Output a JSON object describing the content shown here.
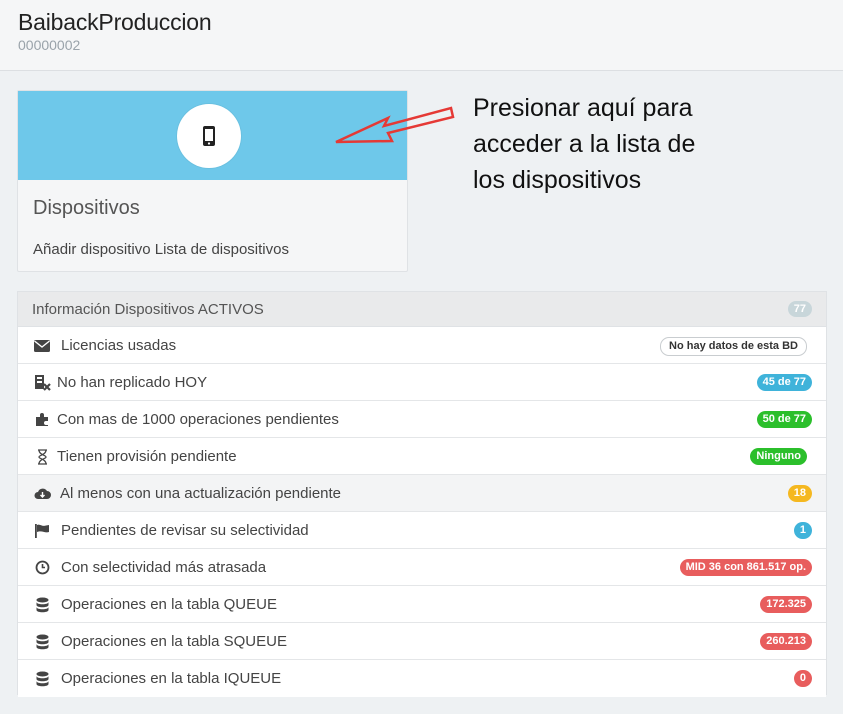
{
  "header": {
    "title": "BaibackProduccion",
    "code": "00000002"
  },
  "card": {
    "icon": "mobile-phone-icon",
    "title": "Dispositivos",
    "link_add": "Añadir dispositivo",
    "link_list": "Lista de dispositivos",
    "banner_color": "#6ec8ea"
  },
  "annotation": {
    "line1": "Presionar aquí para",
    "line2": "acceder a la lista de",
    "line3": "los dispositivos",
    "arrow_color": "#e53935"
  },
  "panel": {
    "title": "Información Dispositivos ACTIVOS",
    "count": "77",
    "rows": [
      {
        "icon": "envelope-icon",
        "label": "Licencias usadas",
        "badge": "No hay datos de esta BD",
        "badge_color": "#ffffff"
      },
      {
        "icon": "server-x-icon",
        "label": "No han replicado HOY",
        "badge": "45 de 77",
        "badge_color": "#3fb3da"
      },
      {
        "icon": "puzzle-icon",
        "label": "Con mas de 1000 operaciones pendientes",
        "badge": "50 de 77",
        "badge_color": "#2bbf2b"
      },
      {
        "icon": "hourglass-icon",
        "label": "Tienen provisión pendiente",
        "badge": "Ninguno",
        "badge_color": "#2bbf2b"
      },
      {
        "icon": "cloud-download-icon",
        "label": "Al menos con una actualización pendiente",
        "badge": "18",
        "badge_color": "#f5b820"
      },
      {
        "icon": "flag-icon",
        "label": "Pendientes de revisar su selectividad",
        "badge": "1",
        "badge_color": "#3fb3da"
      },
      {
        "icon": "clock-icon",
        "label": "Con selectividad más atrasada",
        "badge": "MID 36 con 861.517 op.",
        "badge_color": "#e85d5d"
      },
      {
        "icon": "database-icon",
        "label": "Operaciones en la tabla QUEUE",
        "badge": "172.325",
        "badge_color": "#e85d5d"
      },
      {
        "icon": "database-icon",
        "label": "Operaciones en la tabla SQUEUE",
        "badge": "260.213",
        "badge_color": "#e85d5d"
      },
      {
        "icon": "database-icon",
        "label": "Operaciones en la tabla IQUEUE",
        "badge": "0",
        "badge_color": "#e85d5d"
      }
    ]
  }
}
